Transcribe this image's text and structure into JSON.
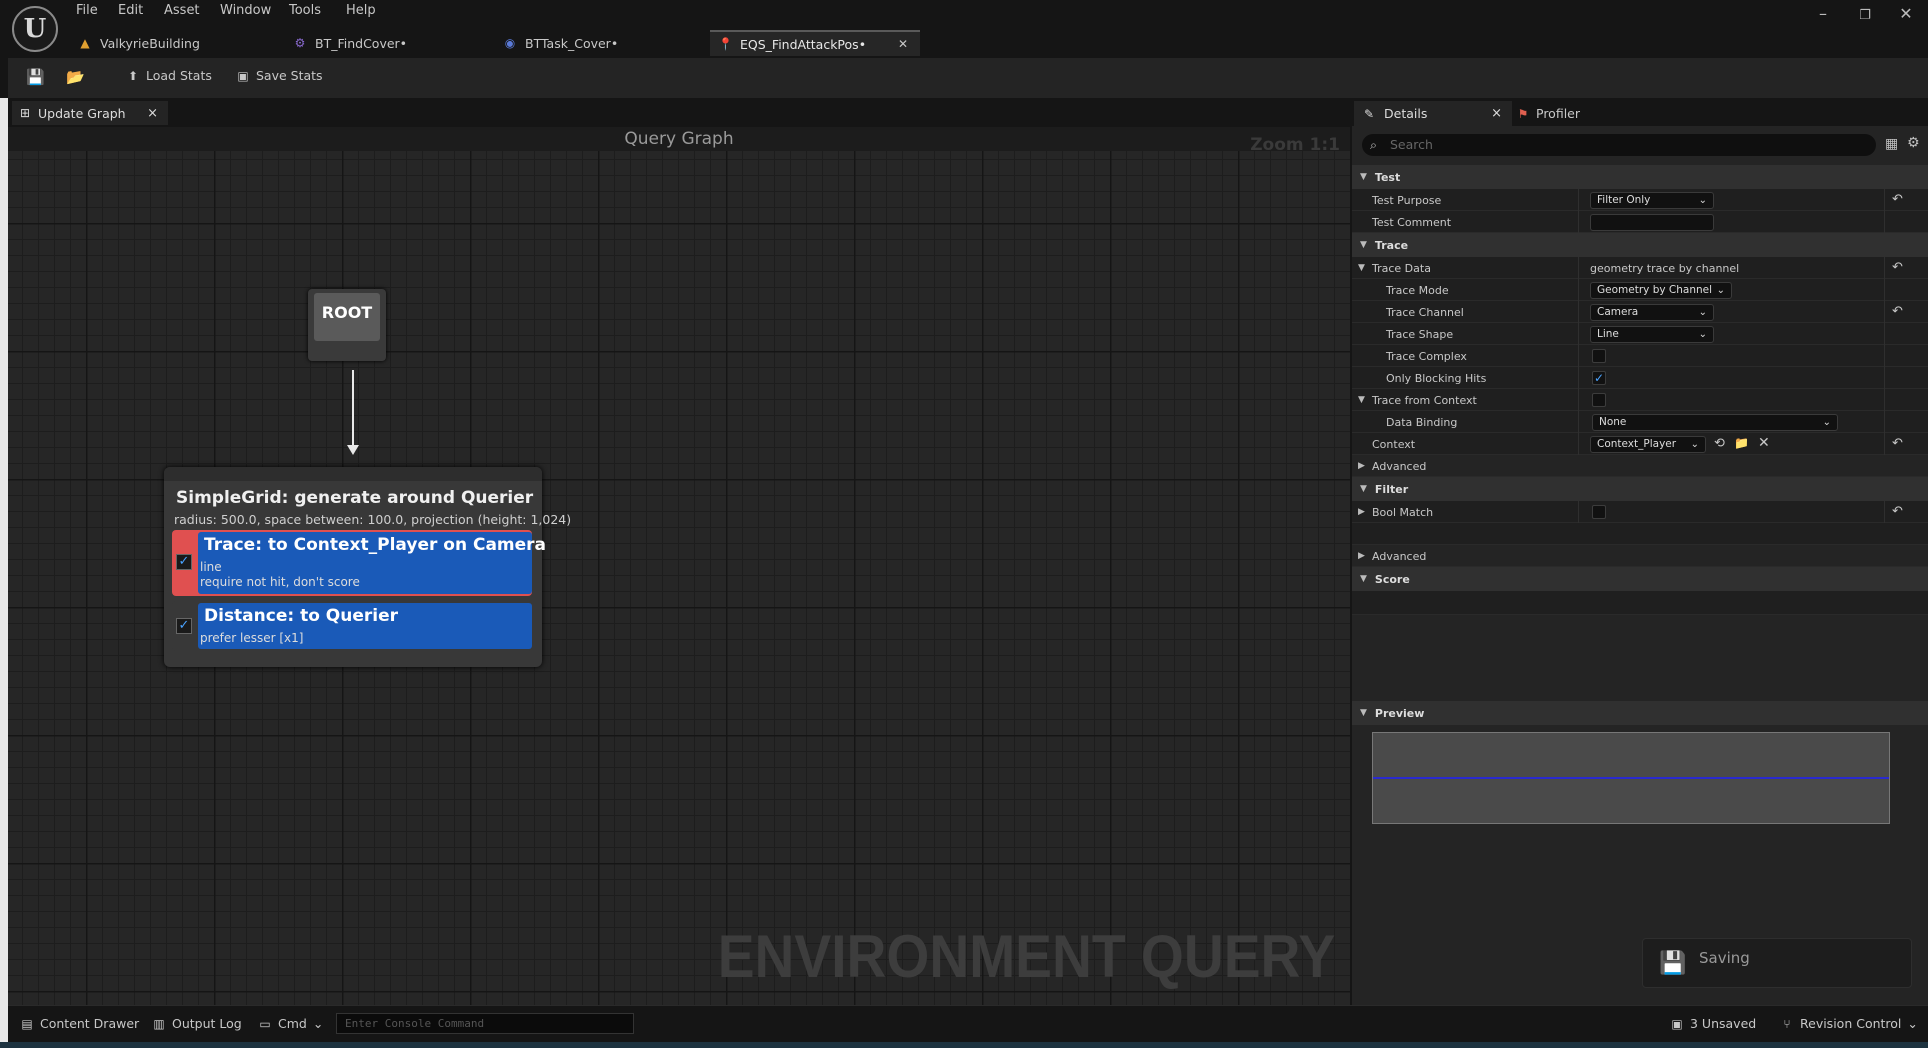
{
  "app": {
    "logo": "U"
  },
  "menu": [
    "File",
    "Edit",
    "Asset",
    "Window",
    "Tools",
    "Help"
  ],
  "window_controls": {
    "minimize": "–",
    "restore": "❐",
    "close": "✕"
  },
  "tabs": [
    {
      "label": "ValkyrieBuilding",
      "icon": "level-icon",
      "icon_color": "#e0a030"
    },
    {
      "label": "BT_FindCover•",
      "icon": "behavior-tree-icon",
      "icon_color": "#8a6ad0"
    },
    {
      "label": "BTTask_Cover•",
      "icon": "blueprint-icon",
      "icon_color": "#5a7ad8"
    },
    {
      "label": "EQS_FindAttackPos•",
      "icon": "eqs-pin-icon",
      "icon_color": "#e04080",
      "active": true,
      "close": "✕"
    }
  ],
  "toolbar": {
    "load_stats": "Load Stats",
    "save_stats": "Save Stats"
  },
  "graph_tab": {
    "label": "Update Graph",
    "close": "×"
  },
  "graph": {
    "title": "Query Graph",
    "zoom": "Zoom 1:1",
    "watermark": "ENVIRONMENT QUERY",
    "root_label": "ROOT",
    "generator": {
      "title": "SimpleGrid: generate around Querier",
      "subtitle": "radius: 500.0, space between: 100.0, projection (height: 1,024)"
    },
    "tests": [
      {
        "title": "Trace: to Context_Player on Camera",
        "lines": [
          "line",
          "require not hit, don't score"
        ],
        "checked": true,
        "selected": true
      },
      {
        "title": "Distance: to Querier",
        "lines": [
          "prefer lesser [x1]"
        ],
        "checked": true,
        "selected": false
      }
    ]
  },
  "details": {
    "tab_label": "Details",
    "tab_close": "×",
    "profiler_label": "Profiler",
    "search_placeholder": "Search",
    "sections": {
      "test": "Test",
      "trace": "Trace",
      "advanced": "Advanced",
      "filter": "Filter",
      "advanced2": "Advanced",
      "score": "Score",
      "preview": "Preview"
    },
    "props": {
      "test_purpose": {
        "label": "Test Purpose",
        "value": "Filter Only"
      },
      "test_comment": {
        "label": "Test Comment",
        "value": ""
      },
      "trace_data": {
        "label": "Trace Data",
        "value": "geometry trace by channel"
      },
      "trace_mode": {
        "label": "Trace Mode",
        "value": "Geometry by Channel"
      },
      "trace_channel": {
        "label": "Trace Channel",
        "value": "Camera"
      },
      "trace_shape": {
        "label": "Trace Shape",
        "value": "Line"
      },
      "trace_complex": {
        "label": "Trace Complex",
        "checked": false
      },
      "only_blocking": {
        "label": "Only Blocking Hits",
        "checked": true
      },
      "trace_from_context": {
        "label": "Trace from Context",
        "checked": false
      },
      "data_binding": {
        "label": "Data Binding",
        "value": "None"
      },
      "context": {
        "label": "Context",
        "value": "Context_Player"
      },
      "bool_match": {
        "label": "Bool Match",
        "checked": false
      }
    }
  },
  "saving": {
    "label": "Saving"
  },
  "bottom": {
    "content_drawer": "Content Drawer",
    "output_log": "Output Log",
    "cmd": "Cmd",
    "console_placeholder": "Enter Console Command",
    "unsaved": "3 Unsaved",
    "revision_control": "Revision Control"
  }
}
